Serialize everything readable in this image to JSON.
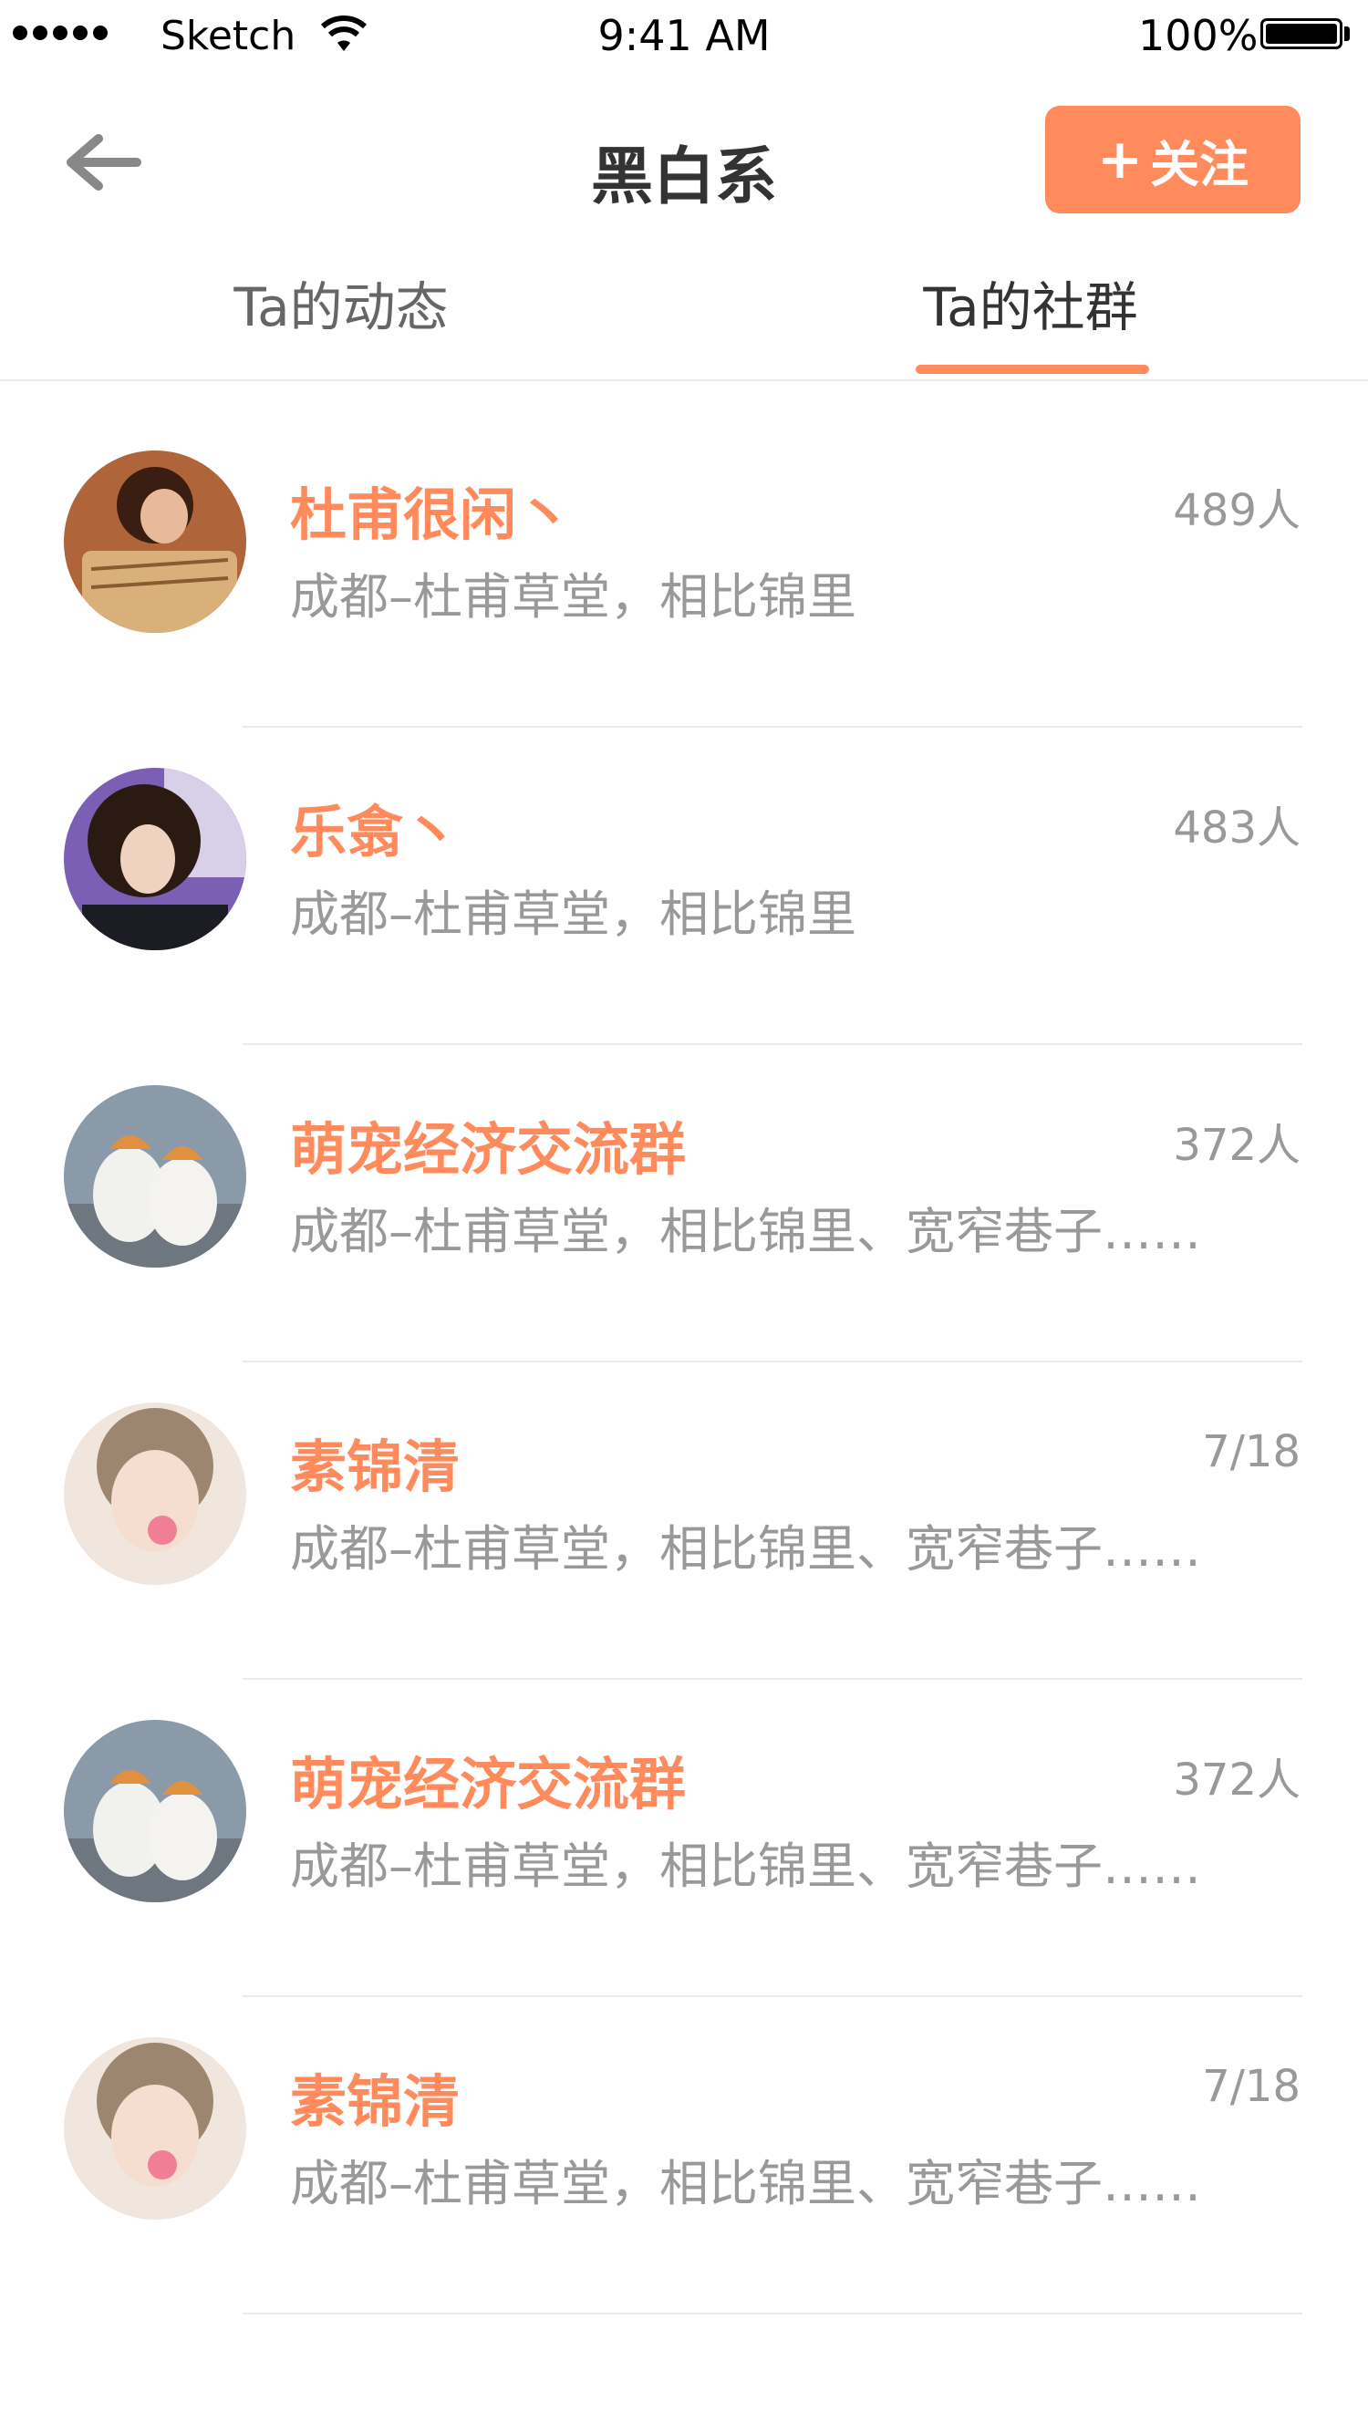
{
  "status_bar": {
    "carrier": "Sketch",
    "time": "9:41 AM",
    "battery": "100%"
  },
  "nav": {
    "title": "黑白系",
    "follow_label": "关注",
    "back_icon": "arrow-left-icon"
  },
  "tabs": [
    {
      "label": "Ta的动态",
      "active": false
    },
    {
      "label": "Ta的社群",
      "active": true
    }
  ],
  "accent_color": "#ff8a5c",
  "groups": [
    {
      "name": "杜甫很闲丶",
      "count": "489人",
      "desc": "成都–杜甫草堂，相比锦里"
    },
    {
      "name": "乐翕丶",
      "count": "483人",
      "desc": "成都–杜甫草堂，相比锦里"
    },
    {
      "name": "萌宠经济交流群",
      "count": "372人",
      "desc": "成都–杜甫草堂，相比锦里、宽窄巷子……"
    },
    {
      "name": "素锦清",
      "count": "7/18",
      "desc": "成都–杜甫草堂，相比锦里、宽窄巷子……"
    },
    {
      "name": "萌宠经济交流群",
      "count": "372人",
      "desc": "成都–杜甫草堂，相比锦里、宽窄巷子……"
    },
    {
      "name": "素锦清",
      "count": "7/18",
      "desc": "成都–杜甫草堂，相比锦里、宽窄巷子……"
    }
  ]
}
